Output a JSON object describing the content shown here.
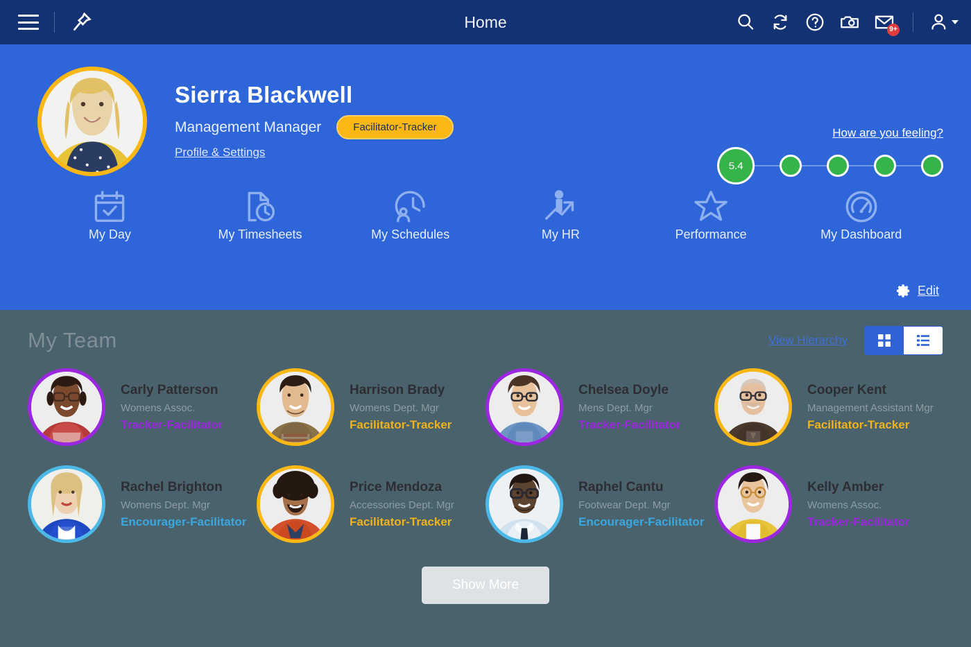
{
  "topbar": {
    "title": "Home",
    "menu_icon": "hamburger-menu-icon",
    "pin_icon": "pin-icon",
    "icons": [
      {
        "name": "search-icon",
        "label": "Search"
      },
      {
        "name": "refresh-icon",
        "label": "Refresh"
      },
      {
        "name": "help-icon",
        "label": "Help"
      },
      {
        "name": "camera-icon",
        "label": "Camera"
      },
      {
        "name": "mail-icon",
        "label": "Messages"
      }
    ],
    "mail_badge": "9+",
    "user_icon": "user-avatar-icon"
  },
  "profile": {
    "name": "Sierra Blackwell",
    "role": "Management Manager",
    "badge": "Facilitator-Tracker",
    "settings_link": "Profile & Settings",
    "avatar_name": "sierra-blackwell-avatar",
    "ring_color": "#fbb714"
  },
  "feeling": {
    "link": "How are you feeling?",
    "score": "5.4",
    "dot_color": "#35b44a",
    "dot_count": 5
  },
  "quicklinks": [
    {
      "label": "My Day",
      "icon": "calendar-check-icon"
    },
    {
      "label": "My Timesheets",
      "icon": "document-clock-icon"
    },
    {
      "label": "My Schedules",
      "icon": "clock-person-icon"
    },
    {
      "label": "My HR",
      "icon": "person-growth-arrow-icon"
    },
    {
      "label": "Performance",
      "icon": "star-icon"
    },
    {
      "label": "My Dashboard",
      "icon": "gauge-icon"
    }
  ],
  "edit": {
    "label": "Edit",
    "icon": "gear-icon"
  },
  "team": {
    "title": "My Team",
    "hierarchy_link": "View Hierarchy",
    "view_grid_icon": "grid-view-icon",
    "view_list_icon": "list-view-icon",
    "active_view": "list",
    "show_more": "Show More",
    "members": [
      {
        "name": "Carly Patterson",
        "dept": "Womens Assoc.",
        "tag": "Tracker-Facilitator",
        "ring": "#9b27e0",
        "tag_color": "#9b27e0",
        "avatar": "carly-patterson-avatar"
      },
      {
        "name": "Harrison Brady",
        "dept": "Womens Dept. Mgr",
        "tag": "Facilitator-Tracker",
        "ring": "#fbb714",
        "tag_color": "#f0b31c",
        "avatar": "harrison-brady-avatar"
      },
      {
        "name": "Chelsea Doyle",
        "dept": "Mens Dept. Mgr",
        "tag": "Tracker-Facilitator",
        "ring": "#9b27e0",
        "tag_color": "#9b27e0",
        "avatar": "chelsea-doyle-avatar"
      },
      {
        "name": "Cooper Kent",
        "dept": "Management Assistant Mgr",
        "tag": "Facilitator-Tracker",
        "ring": "#fbb714",
        "tag_color": "#f0b31c",
        "avatar": "cooper-kent-avatar"
      },
      {
        "name": "Rachel Brighton",
        "dept": "Womens Dept. Mgr",
        "tag": "Encourager-Facilitator",
        "ring": "#4cb8e8",
        "tag_color": "#3aa8e0",
        "avatar": "rachel-brighton-avatar"
      },
      {
        "name": "Price Mendoza",
        "dept": "Accessories Dept. Mgr",
        "tag": "Facilitator-Tracker",
        "ring": "#fbb714",
        "tag_color": "#f0b31c",
        "avatar": "price-mendoza-avatar"
      },
      {
        "name": "Raphel Cantu",
        "dept": "Footwear Dept. Mgr",
        "tag": "Encourager-Facilitator",
        "ring": "#4cb8e8",
        "tag_color": "#3aa8e0",
        "avatar": "raphel-cantu-avatar"
      },
      {
        "name": "Kelly Amber",
        "dept": "Womens Assoc.",
        "tag": "Tracker-Facilitator",
        "ring": "#9b27e0",
        "tag_color": "#9b27e0",
        "avatar": "kelly-amber-avatar"
      }
    ]
  },
  "colors": {
    "topbar_bg": "#123274",
    "hero_bg": "#2e66da",
    "team_bg": "#4a626b",
    "accent_yellow": "#fbb714",
    "accent_blue": "#2f63d4",
    "green": "#35b44a"
  }
}
